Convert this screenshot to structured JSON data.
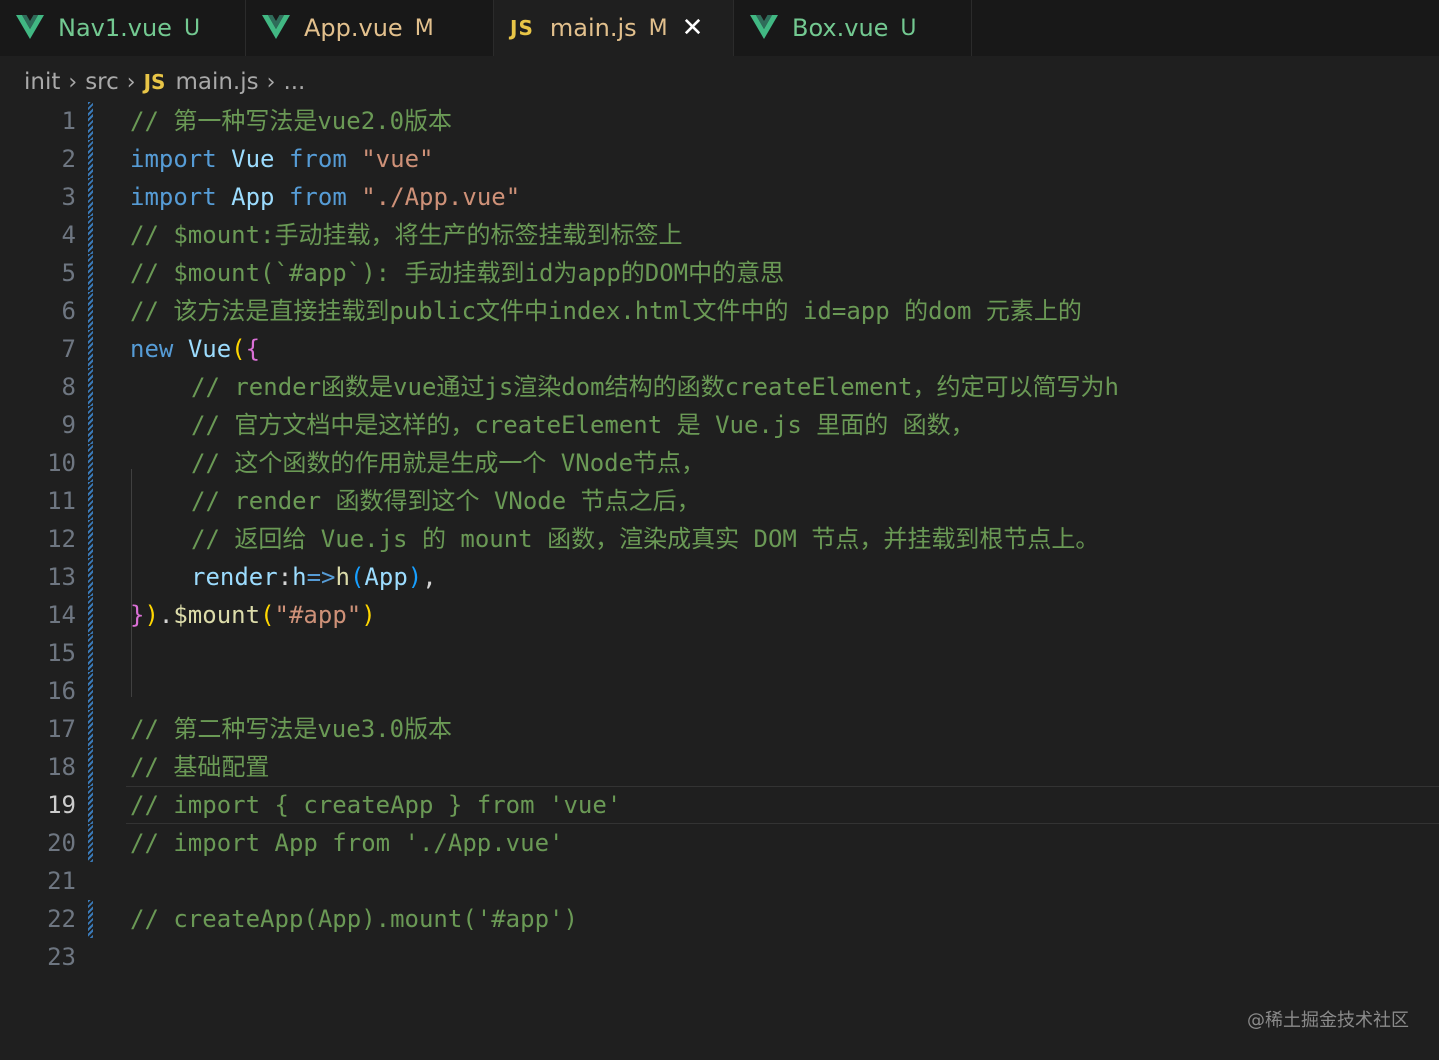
{
  "tabs": [
    {
      "icon": "vue-icon",
      "name": "Nav1.vue",
      "badge": "U",
      "state": "untracked",
      "active": false
    },
    {
      "icon": "vue-icon",
      "name": "App.vue",
      "badge": "M",
      "state": "modified",
      "active": false
    },
    {
      "icon": "js-icon",
      "icon_text": "JS",
      "name": "main.js",
      "badge": "M",
      "state": "modified",
      "active": true,
      "close": "✕"
    },
    {
      "icon": "vue-icon",
      "name": "Box.vue",
      "badge": "U",
      "state": "untracked",
      "active": false
    }
  ],
  "breadcrumb": {
    "items": [
      "init",
      "src",
      "main.js",
      "..."
    ],
    "js_label": "JS"
  },
  "editor": {
    "current_line": 19,
    "line_numbers": [
      "1",
      "2",
      "3",
      "4",
      "5",
      "6",
      "7",
      "8",
      "9",
      "10",
      "11",
      "12",
      "13",
      "14",
      "15",
      "16",
      "17",
      "18",
      "19",
      "20",
      "21",
      "22",
      "23"
    ]
  },
  "code": {
    "l1": "// 第一种写法是vue2.0版本",
    "l4": "// $mount:手动挂载，将生产的标签挂载到标签上",
    "l5": "// $mount(`#app`): 手动挂载到id为app的DOM中的意思",
    "l6": "// 该方法是直接挂载到public文件中index.html文件中的 id=app 的dom 元素上的",
    "l8": "// render函数是vue通过js渲染dom结构的函数createElement，约定可以简写为h",
    "l9": "// 官方文档中是这样的，createElement 是 Vue.js 里面的 函数，",
    "l10": "// 这个函数的作用就是生成一个 VNode节点，",
    "l11": "// render 函数得到这个 VNode 节点之后，",
    "l12": "// 返回给 Vue.js 的 mount 函数，渲染成真实 DOM 节点，并挂载到根节点上。",
    "l17": "// 第二种写法是vue3.0版本",
    "l18": "// 基础配置",
    "l19": "// import { createApp } from 'vue'",
    "l20": "// import App from './App.vue'",
    "l22": "// createApp(App).mount('#app')",
    "kw_import": "import",
    "kw_from": "from",
    "kw_new": "new",
    "id_vue": "Vue",
    "id_app": "App",
    "str_vue": "\"vue\"",
    "str_app_path": "\"./App.vue\"",
    "render_prop": "render",
    "colon": ":",
    "param_h": "h",
    "arrow": "=>",
    "call_h": "h",
    "mount_fn": "$mount",
    "str_hash_app": "\"#app\"",
    "comma": ","
  },
  "watermark": "@稀土掘金技术社区",
  "colors": {
    "comment": "#6a9955",
    "keyword": "#569cd6",
    "string": "#ce9178",
    "bracket_pink": "#da70d6",
    "bracket_blue": "#179fff",
    "bracket_gold": "#ffd700",
    "untracked": "#73c991",
    "modified": "#e2c08d"
  }
}
